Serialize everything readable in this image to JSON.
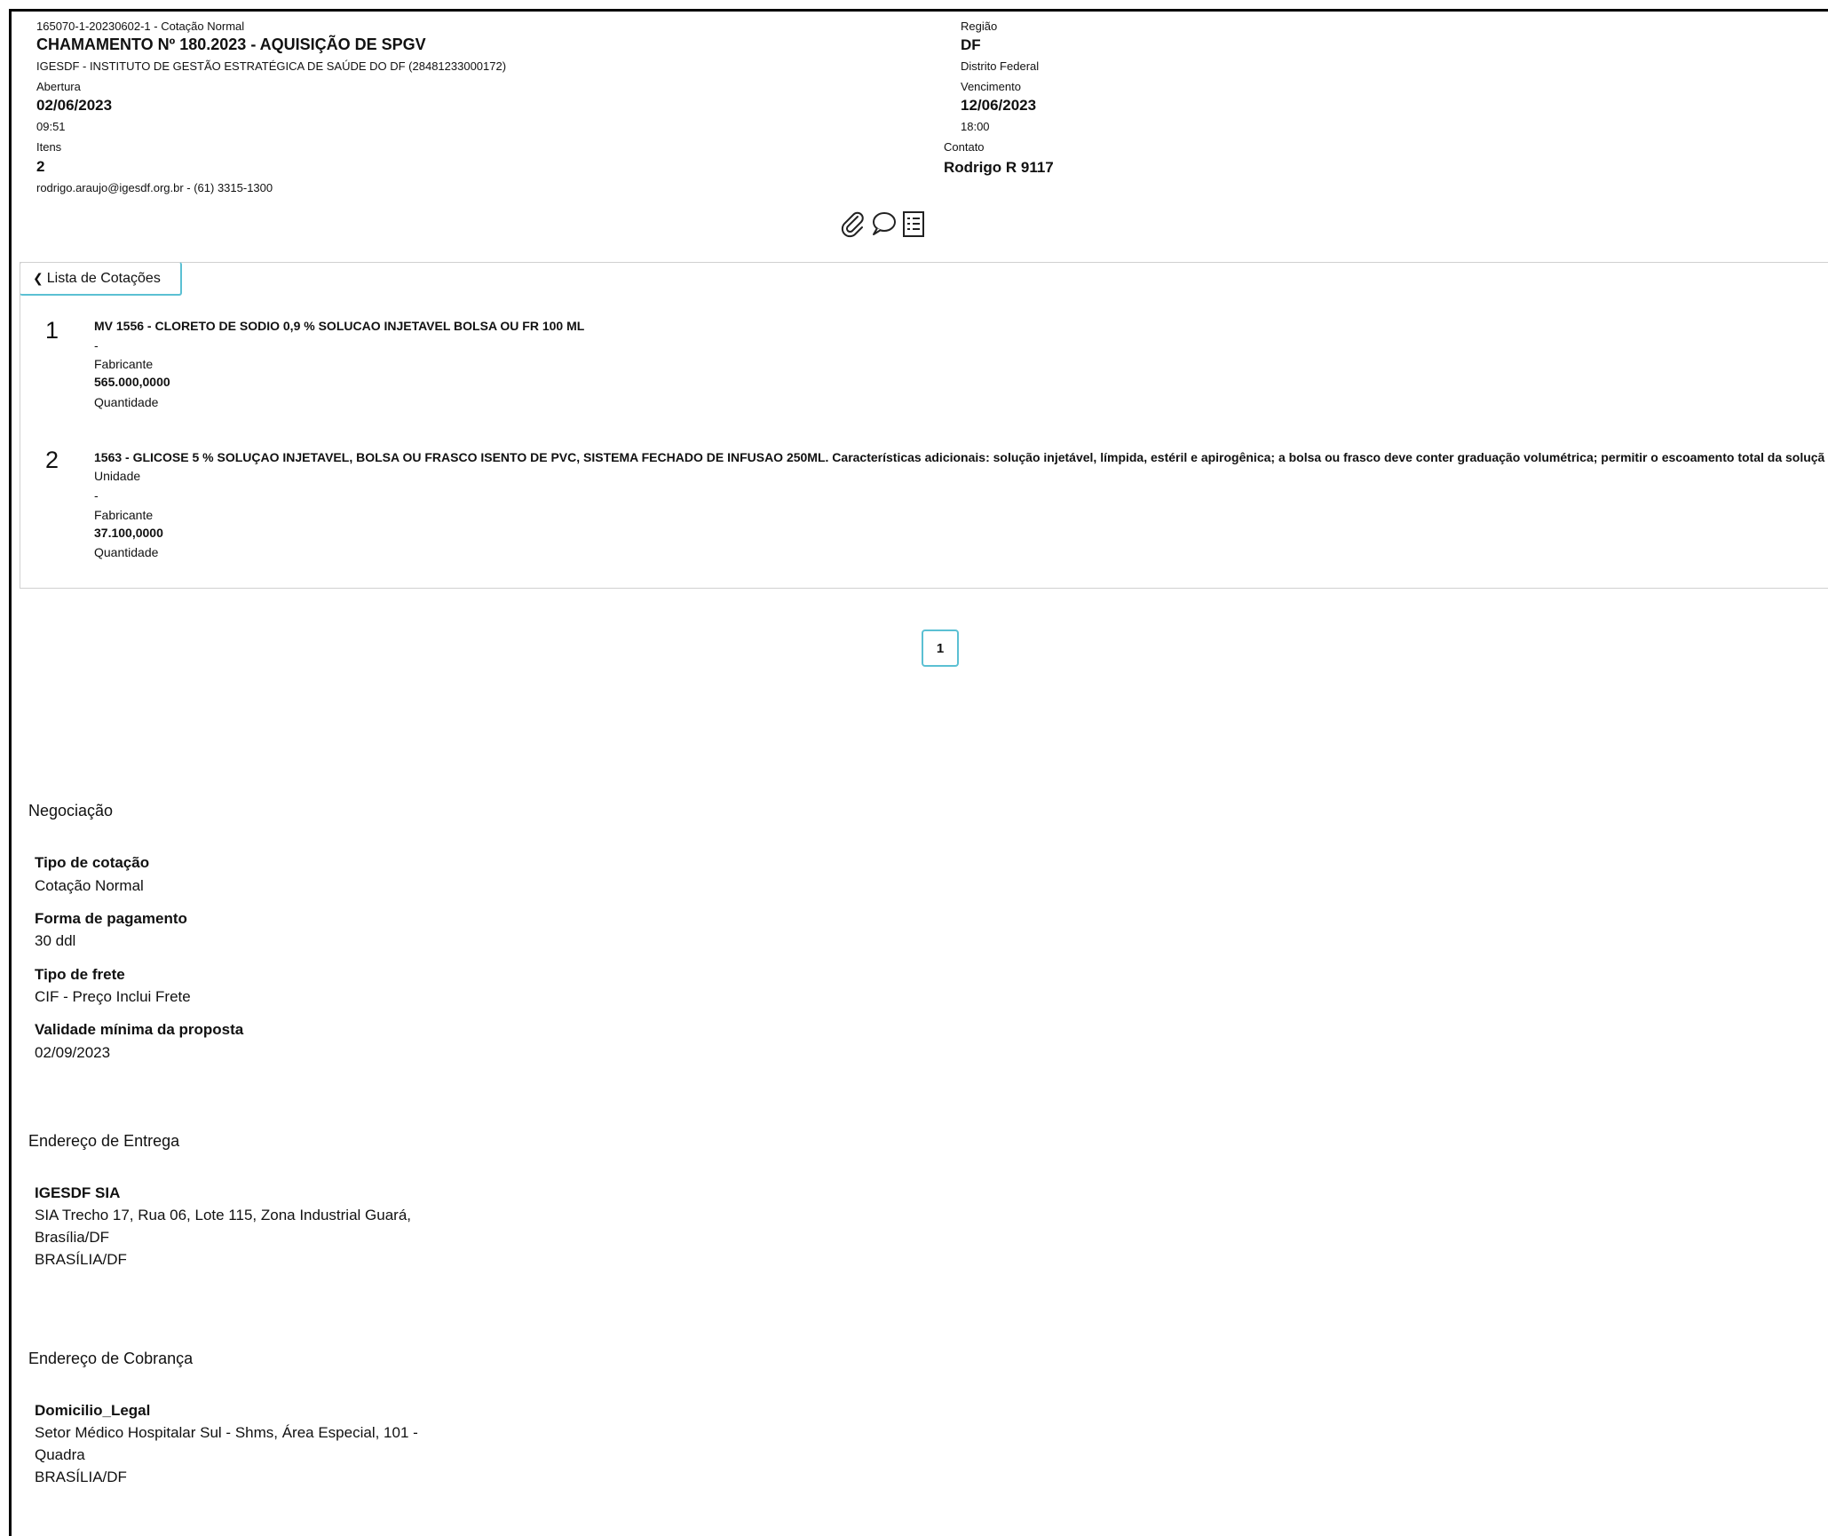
{
  "header": {
    "ref_line": "165070-1-20230602-1 - Cotação Normal",
    "title": "CHAMAMENTO Nº 180.2023 - AQUISIÇÃO DE SPGV",
    "org": "IGESDF - INSTITUTO DE GESTÃO ESTRATÉGICA DE SAÚDE DO DF (28481233000172)",
    "abertura_label": "Abertura",
    "abertura_date": "02/06/2023",
    "abertura_time": "09:51",
    "itens_label": "Itens",
    "itens_value": "2",
    "contact_line": "rodrigo.araujo@igesdf.org.br - (61) 3315-1300",
    "regiao_label": "Região",
    "regiao_value": "DF",
    "regiao_name": "Distrito Federal",
    "vencimento_label": "Vencimento",
    "vencimento_date": "12/06/2023",
    "vencimento_time": "18:00",
    "contato_label": "Contato",
    "contato_value": "Rodrigo R 9117"
  },
  "icons": [
    "paperclip-icon",
    "speech-bubble-icon",
    "checklist-icon"
  ],
  "back_button": {
    "label": "Lista de Cotações"
  },
  "items": [
    {
      "number": "1",
      "description": "MV 1556 - CLORETO DE SODIO 0,9 % SOLUCAO INJETAVEL BOLSA OU FR 100 ML",
      "dash": "-",
      "fabricante_label": "Fabricante",
      "quantity": "565.000,0000",
      "quantidade_label": "Quantidade"
    },
    {
      "number": "2",
      "description": "1563 - GLICOSE 5 % SOLUÇAO INJETAVEL, BOLSA OU FRASCO ISENTO DE PVC, SISTEMA FECHADO DE INFUSAO 250ML. Características adicionais: solução injetável, límpida, estéril e apirogênica; a bolsa ou frasco deve conter graduação volumétrica; permitir o escoamento total da soluçã",
      "unidade_label": "Unidade",
      "dash": "-",
      "fabricante_label": "Fabricante",
      "quantity": "37.100,0000",
      "quantidade_label": "Quantidade"
    }
  ],
  "pagination": {
    "current": "1"
  },
  "negociacao": {
    "title": "Negociação",
    "tipo_cotacao_label": "Tipo de cotação",
    "tipo_cotacao_value": "Cotação Normal",
    "forma_pagamento_label": "Forma de pagamento",
    "forma_pagamento_value": "30 ddl",
    "tipo_frete_label": "Tipo de frete",
    "tipo_frete_value": "CIF - Preço Inclui Frete",
    "validade_label": "Validade mínima da proposta",
    "validade_value": "02/09/2023"
  },
  "entrega": {
    "title": "Endereço de Entrega",
    "name": "IGESDF SIA",
    "line1": "SIA Trecho 17, Rua 06, Lote 115, Zona Industrial Guará,",
    "line2": "Brasília/DF",
    "city": "BRASÍLIA/DF"
  },
  "cobranca": {
    "title": "Endereço de Cobrança",
    "name": "Domicilio_Legal",
    "line1": "Setor Médico Hospitalar Sul - Shms, Área Especial, 101 -",
    "line2": "Quadra",
    "city": "BRASÍLIA/DF"
  }
}
